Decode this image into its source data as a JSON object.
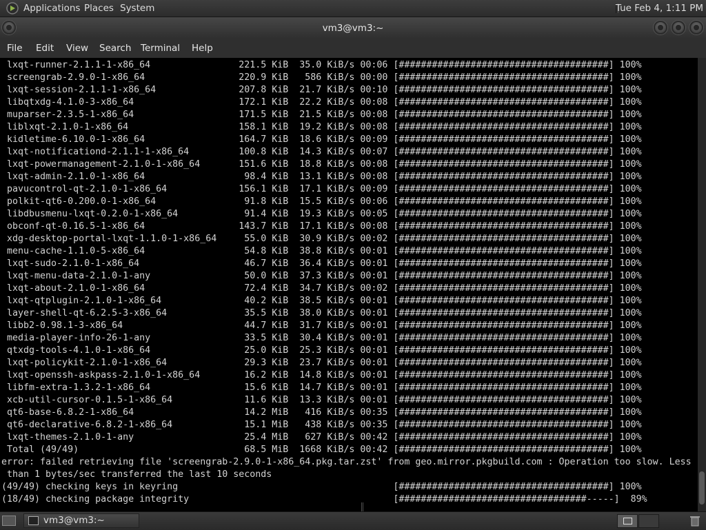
{
  "top_panel": {
    "applications": "Applications",
    "places": "Places",
    "system": "System",
    "clock": "Tue Feb  4,  1:11 PM"
  },
  "window": {
    "title": "vm3@vm3:~"
  },
  "menubar": [
    "File",
    "Edit",
    "View",
    "Search",
    "Terminal",
    "Help"
  ],
  "terminal": {
    "lines": [
      " lxqt-runner-2.1.1-1-x86_64                221.5 KiB  35.0 KiB/s 00:06 [######################################] 100%",
      " screengrab-2.9.0-1-x86_64                 220.9 KiB   586 KiB/s 00:00 [######################################] 100%",
      " lxqt-session-2.1.1-1-x86_64               207.8 KiB  21.7 KiB/s 00:10 [######################################] 100%",
      " libqtxdg-4.1.0-3-x86_64                   172.1 KiB  22.2 KiB/s 00:08 [######################################] 100%",
      " muparser-2.3.5-1-x86_64                   171.5 KiB  21.5 KiB/s 00:08 [######################################] 100%",
      " liblxqt-2.1.0-1-x86_64                    158.1 KiB  19.2 KiB/s 00:08 [######################################] 100%",
      " kidletime-6.10.0-1-x86_64                 164.7 KiB  18.6 KiB/s 00:09 [######################################] 100%",
      " lxqt-notificationd-2.1.1-1-x86_64         100.8 KiB  14.3 KiB/s 00:07 [######################################] 100%",
      " lxqt-powermanagement-2.1.0-1-x86_64       151.6 KiB  18.8 KiB/s 00:08 [######################################] 100%",
      " lxqt-admin-2.1.0-1-x86_64                  98.4 KiB  13.1 KiB/s 00:08 [######################################] 100%",
      " pavucontrol-qt-2.1.0-1-x86_64             156.1 KiB  17.1 KiB/s 00:09 [######################################] 100%",
      " polkit-qt6-0.200.0-1-x86_64                91.8 KiB  15.5 KiB/s 00:06 [######################################] 100%",
      " libdbusmenu-lxqt-0.2.0-1-x86_64            91.4 KiB  19.3 KiB/s 00:05 [######################################] 100%",
      " obconf-qt-0.16.5-1-x86_64                 143.7 KiB  17.1 KiB/s 00:08 [######################################] 100%",
      " xdg-desktop-portal-lxqt-1.1.0-1-x86_64     55.0 KiB  30.9 KiB/s 00:02 [######################################] 100%",
      " menu-cache-1.1.0-5-x86_64                  54.8 KiB  38.8 KiB/s 00:01 [######################################] 100%",
      " lxqt-sudo-2.1.0-1-x86_64                   46.7 KiB  36.4 KiB/s 00:01 [######################################] 100%",
      " lxqt-menu-data-2.1.0-1-any                 50.0 KiB  37.3 KiB/s 00:01 [######################################] 100%",
      " lxqt-about-2.1.0-1-x86_64                  72.4 KiB  34.7 KiB/s 00:02 [######################################] 100%",
      " lxqt-qtplugin-2.1.0-1-x86_64               40.2 KiB  38.5 KiB/s 00:01 [######################################] 100%",
      " layer-shell-qt-6.2.5-3-x86_64              35.5 KiB  38.0 KiB/s 00:01 [######################################] 100%",
      " libb2-0.98.1-3-x86_64                      44.7 KiB  31.7 KiB/s 00:01 [######################################] 100%",
      " media-player-info-26-1-any                 33.5 KiB  30.4 KiB/s 00:01 [######################################] 100%",
      " qtxdg-tools-4.1.0-1-x86_64                 25.0 KiB  25.3 KiB/s 00:01 [######################################] 100%",
      " lxqt-policykit-2.1.0-1-x86_64              29.3 KiB  23.7 KiB/s 00:01 [######################################] 100%",
      " lxqt-openssh-askpass-2.1.0-1-x86_64        16.2 KiB  14.8 KiB/s 00:01 [######################################] 100%",
      " libfm-extra-1.3.2-1-x86_64                 15.6 KiB  14.7 KiB/s 00:01 [######################################] 100%",
      " xcb-util-cursor-0.1.5-1-x86_64             11.6 KiB  13.3 KiB/s 00:01 [######################################] 100%",
      " qt6-base-6.8.2-1-x86_64                    14.2 MiB   416 KiB/s 00:35 [######################################] 100%",
      " qt6-declarative-6.8.2-1-x86_64             15.1 MiB   438 KiB/s 00:35 [######################################] 100%",
      " lxqt-themes-2.1.0-1-any                    25.4 MiB   627 KiB/s 00:42 [######################################] 100%",
      " Total (49/49)                              68.5 MiB  1668 KiB/s 00:42 [######################################] 100%",
      "error: failed retrieving file 'screengrab-2.9.0-1-x86_64.pkg.tar.zst' from geo.mirror.pkgbuild.com : Operation too slow. Less",
      " than 1 bytes/sec transferred the last 10 seconds",
      "(49/49) checking keys in keyring                                       [######################################] 100%",
      "(18/49) checking package integrity                                     [##################################-----]  89%"
    ]
  },
  "bottom_panel": {
    "task_label": "vm3@vm3:~"
  }
}
